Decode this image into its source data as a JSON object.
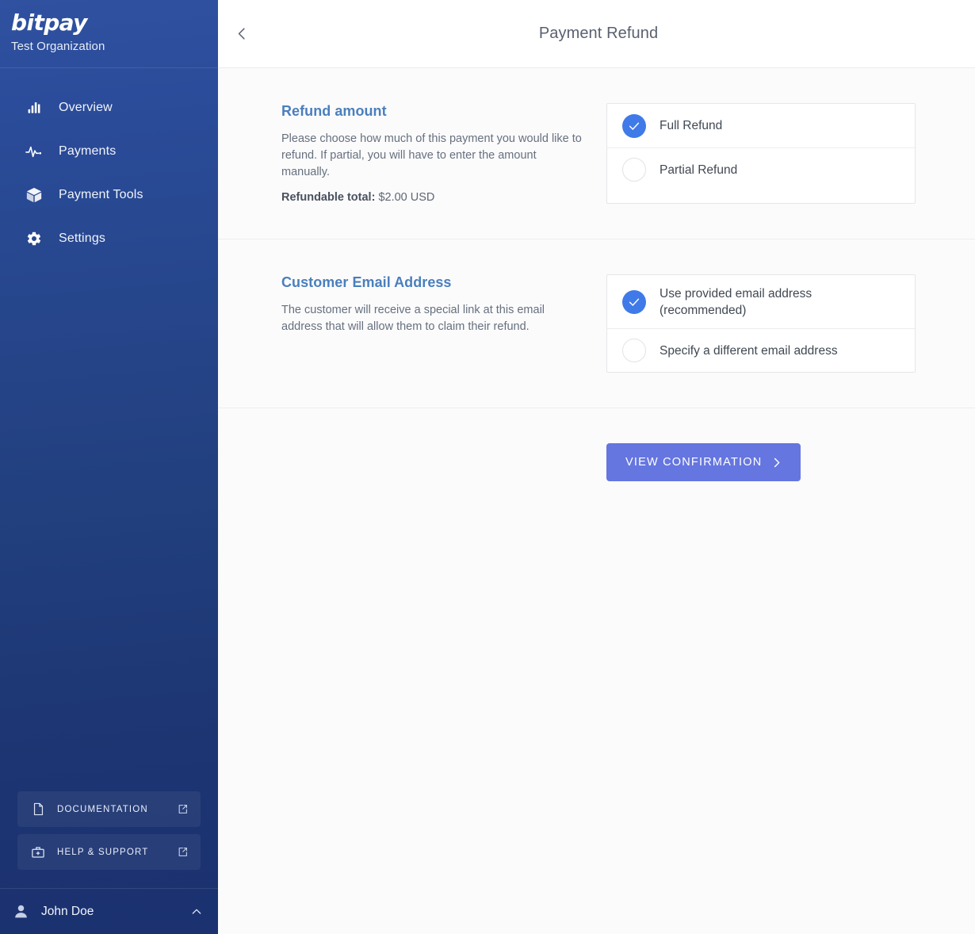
{
  "sidebar": {
    "logo_text": "bitpay",
    "organization": "Test Organization",
    "nav": [
      {
        "label": "Overview",
        "icon": "bar-chart-icon"
      },
      {
        "label": "Payments",
        "icon": "activity-pulse-icon"
      },
      {
        "label": "Payment Tools",
        "icon": "box-icon"
      },
      {
        "label": "Settings",
        "icon": "gear-icon"
      }
    ],
    "links": [
      {
        "label": "DOCUMENTATION",
        "icon": "document-icon",
        "ext_icon": "external-link-icon"
      },
      {
        "label": "HELP & SUPPORT",
        "icon": "first-aid-icon",
        "ext_icon": "external-link-icon"
      }
    ],
    "user": {
      "name": "John Doe",
      "avatar_icon": "user-avatar-icon",
      "caret_icon": "chevron-up-icon"
    }
  },
  "header": {
    "back_icon": "chevron-left-icon",
    "title": "Payment Refund"
  },
  "sections": [
    {
      "title": "Refund amount",
      "description": "Please choose how much of this payment you would like to refund. If partial, you will have to enter the amount manually.",
      "refundable_label": "Refundable total:",
      "refundable_value": "$2.00 USD",
      "options": [
        {
          "label": "Full Refund",
          "selected": true
        },
        {
          "label": "Partial Refund",
          "selected": false
        }
      ]
    },
    {
      "title": "Customer Email Address",
      "description": "The customer will receive a special link at this email address that will allow them to claim their refund.",
      "options": [
        {
          "label": "Use provided email address (recommended)",
          "selected": true
        },
        {
          "label": "Specify a different email address",
          "selected": false
        }
      ]
    }
  ],
  "cta": {
    "label": "VIEW CONFIRMATION",
    "arrow_icon": "chevron-right-icon"
  },
  "colors": {
    "sidebar_top": "#2f51a0",
    "sidebar_bottom": "#1b3170",
    "accent_blue": "#3f7ae8",
    "section_title": "#4a7fbd",
    "cta_bg": "#6576e0",
    "content_bg": "#fbfbfc"
  }
}
